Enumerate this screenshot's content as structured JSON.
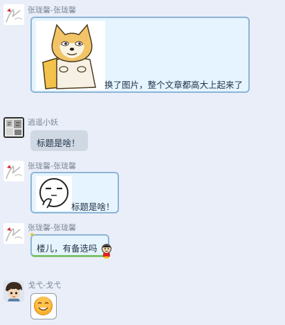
{
  "messages": [
    {
      "sender": "张珑馨-张珑馨",
      "text": "换了图片，整个文章都高大上起来了",
      "image": "shiba-doge-sticker"
    },
    {
      "sender": "逍遥小妖",
      "text": "标题是啥！"
    },
    {
      "sender": "张珑馨-张珑馨",
      "text": "标题是啥！",
      "image": "thinking-face-sticker"
    },
    {
      "sender": "张珑馨-张珑馨",
      "text": "楼儿，有备选吗",
      "image": "crayon-shin-chan-sticker"
    },
    {
      "sender": "戈弋-戈弋",
      "image": "smile-emoji"
    }
  ],
  "colors": {
    "background": "#eaeef8",
    "bubble_blue": "#e5f4fe",
    "bubble_blue_border": "#8cb4d6",
    "bubble_grey": "#cfd8e3",
    "name_text": "#7a8696",
    "message_text": "#233448",
    "accent_green": "#7cc26e"
  }
}
